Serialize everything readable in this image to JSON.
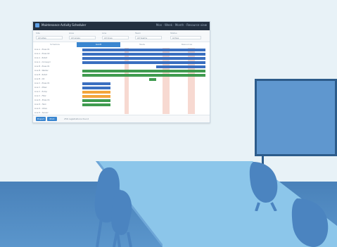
{
  "monitor": {
    "title": "Maintenance Activity Scheduler",
    "actions": "Mon · Week · Month · Resource view",
    "filters": [
      {
        "label": "Site",
        "value": "All sites"
      },
      {
        "label": "Area",
        "value": "All areas"
      },
      {
        "label": "Line",
        "value": "All lines"
      },
      {
        "label": "Team",
        "value": "All teams"
      },
      {
        "label": "Status",
        "value": "Active"
      }
    ],
    "tabs": [
      "Schedule",
      "Gantt",
      "Tasks",
      "Resources"
    ],
    "active_tab": 1,
    "rows": [
      "Line A - Press 01",
      "Line A - Press 02",
      "Line A - Robot",
      "Line A - Conveyor",
      "Line B - Press 01",
      "Line B - Welder",
      "Line B - Robot",
      "Line B - QC",
      "Line C - Press 01",
      "Line C - Mixer",
      "Line C - Pump",
      "Line C - Filler",
      "Line D - Press 01",
      "Line D - Tank",
      "Line D - Valve",
      "Line D - Sensor"
    ],
    "buttons": [
      "Export",
      "Print"
    ],
    "footer_text": "256 registrations found"
  },
  "colors": {
    "wall": "#e8f2f7",
    "floor": "#5b96cc",
    "accent": "#3a86d0",
    "bar_blue": "#3a6fc0",
    "bar_green": "#3f9b4f",
    "bar_orange": "#f3a53b",
    "highlight": "#f6d2c9"
  }
}
